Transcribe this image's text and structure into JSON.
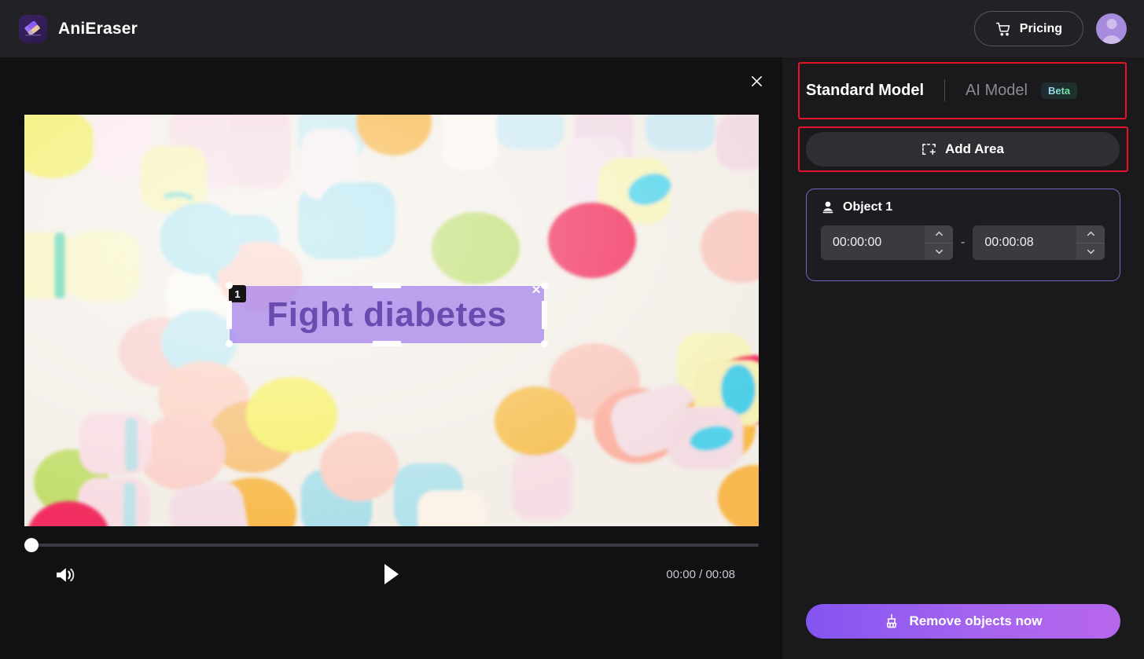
{
  "header": {
    "brand_name": "AniEraser",
    "logo_icon": "eraser-icon",
    "pricing_label": "Pricing",
    "cart_icon": "cart-icon",
    "avatar_icon": "user-avatar-icon"
  },
  "editor": {
    "close_icon": "close-icon",
    "video": {
      "selection": {
        "badge": "1",
        "text": "Fight diabetes",
        "close_icon": "close-icon",
        "fill_color": "#966eeb",
        "text_color": "#6a4bb0"
      }
    },
    "player": {
      "volume_icon": "volume-icon",
      "play_icon": "play-icon",
      "time_display": "00:00 / 00:08",
      "progress_percent": 0
    }
  },
  "panel": {
    "tabs": [
      {
        "label": "Standard Model",
        "active": true
      },
      {
        "label": "AI Model",
        "active": false,
        "badge": "Beta"
      }
    ],
    "add_area": {
      "label": "Add Area",
      "icon": "add-area-icon"
    },
    "object": {
      "icon": "person-icon",
      "title": "Object 1",
      "start_time": "00:00:00",
      "end_time": "00:00:08",
      "separator": "-",
      "up_icon": "chevron-up-icon",
      "down_icon": "chevron-down-icon",
      "border_color": "#7d62c4"
    },
    "remove_button": {
      "label": "Remove objects now",
      "icon": "broom-icon",
      "accent": "#a564ef"
    },
    "annotation_color": "#e8132b"
  }
}
